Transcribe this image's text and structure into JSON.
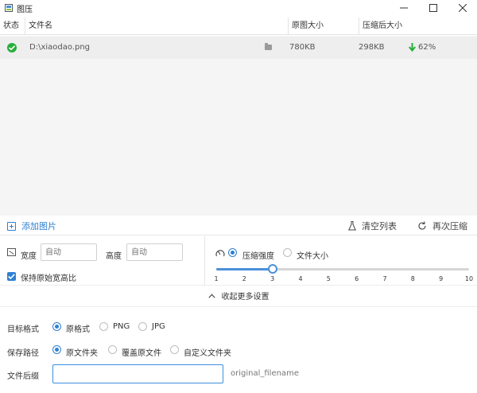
{
  "window": {
    "title": "图压",
    "minimize_glyph": "—",
    "maximize_glyph": "☐",
    "close_glyph": "✕"
  },
  "table": {
    "headers": [
      "状态",
      "文件名",
      "原图大小",
      "压缩后大小"
    ],
    "rows": [
      {
        "status_icon": "check-circle-icon",
        "filename": "D:\\xiaodao.png",
        "original_size": "780KB",
        "compressed_size": "298KB",
        "ratio": "62%"
      }
    ]
  },
  "actions": {
    "add_image": "添加图片",
    "clear_list": "清空列表",
    "recompress": "再次压缩"
  },
  "dimensions": {
    "width_label": "宽度",
    "width_placeholder": "自动",
    "height_label": "高度",
    "height_placeholder": "自动",
    "keep_ratio_label": "保持原始宽高比",
    "keep_ratio_checked": true
  },
  "compression": {
    "mode_strength_label": "压缩强度",
    "mode_filesize_label": "文件大小",
    "selected_mode": "strength",
    "slider_min": 1,
    "slider_max": 10,
    "slider_value": 3,
    "ticks": [
      "1",
      "2",
      "3",
      "4",
      "5",
      "6",
      "7",
      "8",
      "9",
      "10"
    ]
  },
  "collapse_label": "收起更多设置",
  "target_format": {
    "label": "目标格式",
    "options": [
      "原格式",
      "PNG",
      "JPG"
    ],
    "selected": 0
  },
  "save_path": {
    "label": "保存路径",
    "options": [
      "原文件夹",
      "覆盖原文件",
      "自定义文件夹"
    ],
    "selected": 0
  },
  "file_suffix": {
    "label": "文件后缀",
    "value": "",
    "hint": "original_filename"
  },
  "colors": {
    "accent": "#2f80d1",
    "success": "#27ae3a",
    "row_bg": "#eeeeee"
  }
}
